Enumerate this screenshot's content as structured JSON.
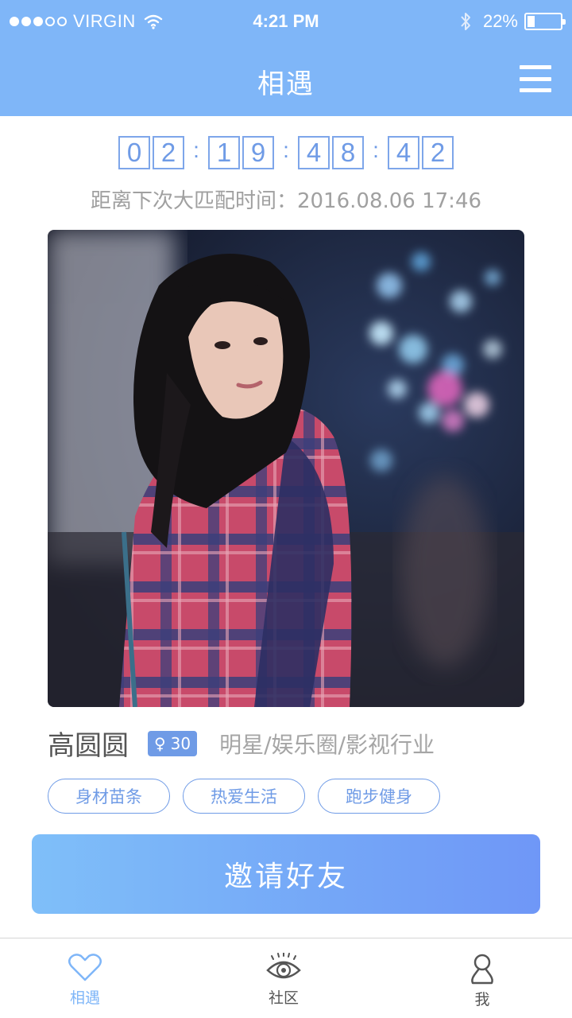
{
  "status_bar": {
    "carrier": "VIRGIN",
    "time": "4:21 PM",
    "battery_percent": "22%",
    "battery_level": 0.22,
    "signal_strength": 3,
    "signal_max": 5
  },
  "header": {
    "title": "相遇",
    "menu_icon": "hamburger-menu-icon",
    "background_color": "#7fb6f8"
  },
  "countdown": {
    "digits": [
      "0",
      "2",
      "1",
      "9",
      "4",
      "8",
      "4",
      "2"
    ],
    "separator": ":"
  },
  "next_match": {
    "text": "距离下次大匹配时间：2016.08.06 17:46"
  },
  "profile": {
    "name": "高圆圆",
    "gender_symbol": "♀",
    "age": "30",
    "occupation": "明星/娱乐圈/影视行业",
    "tags": [
      "身材苗条",
      "热爱生活",
      "跑步健身"
    ]
  },
  "invite_button": {
    "label": "邀请好友"
  },
  "tabbar": {
    "tabs": [
      {
        "label": "相遇",
        "icon": "heart-icon",
        "active": true
      },
      {
        "label": "社区",
        "icon": "eye-icon",
        "active": false
      },
      {
        "label": "我",
        "icon": "user-icon",
        "active": false
      }
    ]
  },
  "colors": {
    "accent": "#7fb6f8",
    "digit_blue": "#6f9be6",
    "gray_text": "#a0a0a0"
  }
}
